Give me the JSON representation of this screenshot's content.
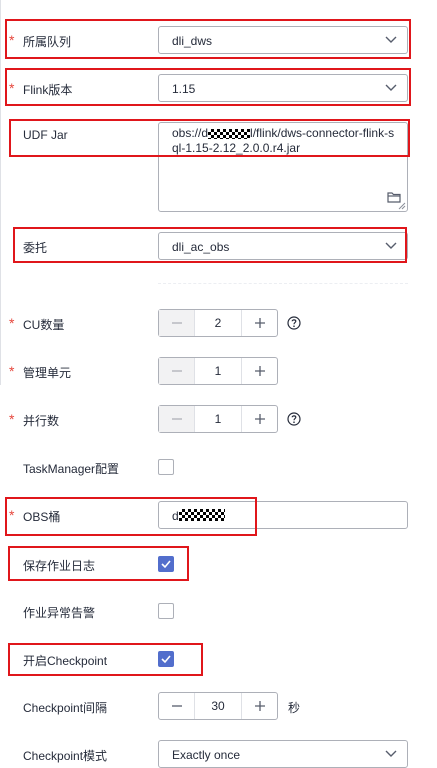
{
  "form": {
    "queue": {
      "label": "所属队列",
      "value": "dli_dws"
    },
    "flink_version": {
      "label": "Flink版本",
      "value": "1.15"
    },
    "udf_jar": {
      "label": "UDF Jar",
      "value_prefix": "obs://d",
      "value_suffix": "l/flink/dws-connector-flink-sql-1.15-2.12_2.0.0.r4.jar"
    },
    "agency": {
      "label": "委托",
      "value": "dli_ac_obs"
    },
    "cu_count": {
      "label": "CU数量",
      "value": "2"
    },
    "management_unit": {
      "label": "管理单元",
      "value": "1"
    },
    "parallelism": {
      "label": "并行数",
      "value": "1"
    },
    "taskmanager_config": {
      "label": "TaskManager配置",
      "checked": false
    },
    "obs_bucket": {
      "label": "OBS桶",
      "value_prefix": "d"
    },
    "save_job_log": {
      "label": "保存作业日志",
      "checked": true
    },
    "job_alarm": {
      "label": "作业异常告警",
      "checked": false
    },
    "enable_checkpoint": {
      "label": "开启Checkpoint",
      "checked": true
    },
    "checkpoint_interval": {
      "label": "Checkpoint间隔",
      "value": "30",
      "unit": "秒"
    },
    "checkpoint_mode": {
      "label": "Checkpoint模式",
      "value": "Exactly once"
    }
  },
  "required_mark": "*",
  "colors": {
    "required": "#e6463c",
    "highlight": "#e0161b",
    "checkbox_checked": "#526ecc",
    "border": "#adb0b8"
  },
  "icons": [
    "chevron-down-icon",
    "folder-icon",
    "minus-icon",
    "plus-icon",
    "help-circle-icon",
    "check-icon"
  ]
}
